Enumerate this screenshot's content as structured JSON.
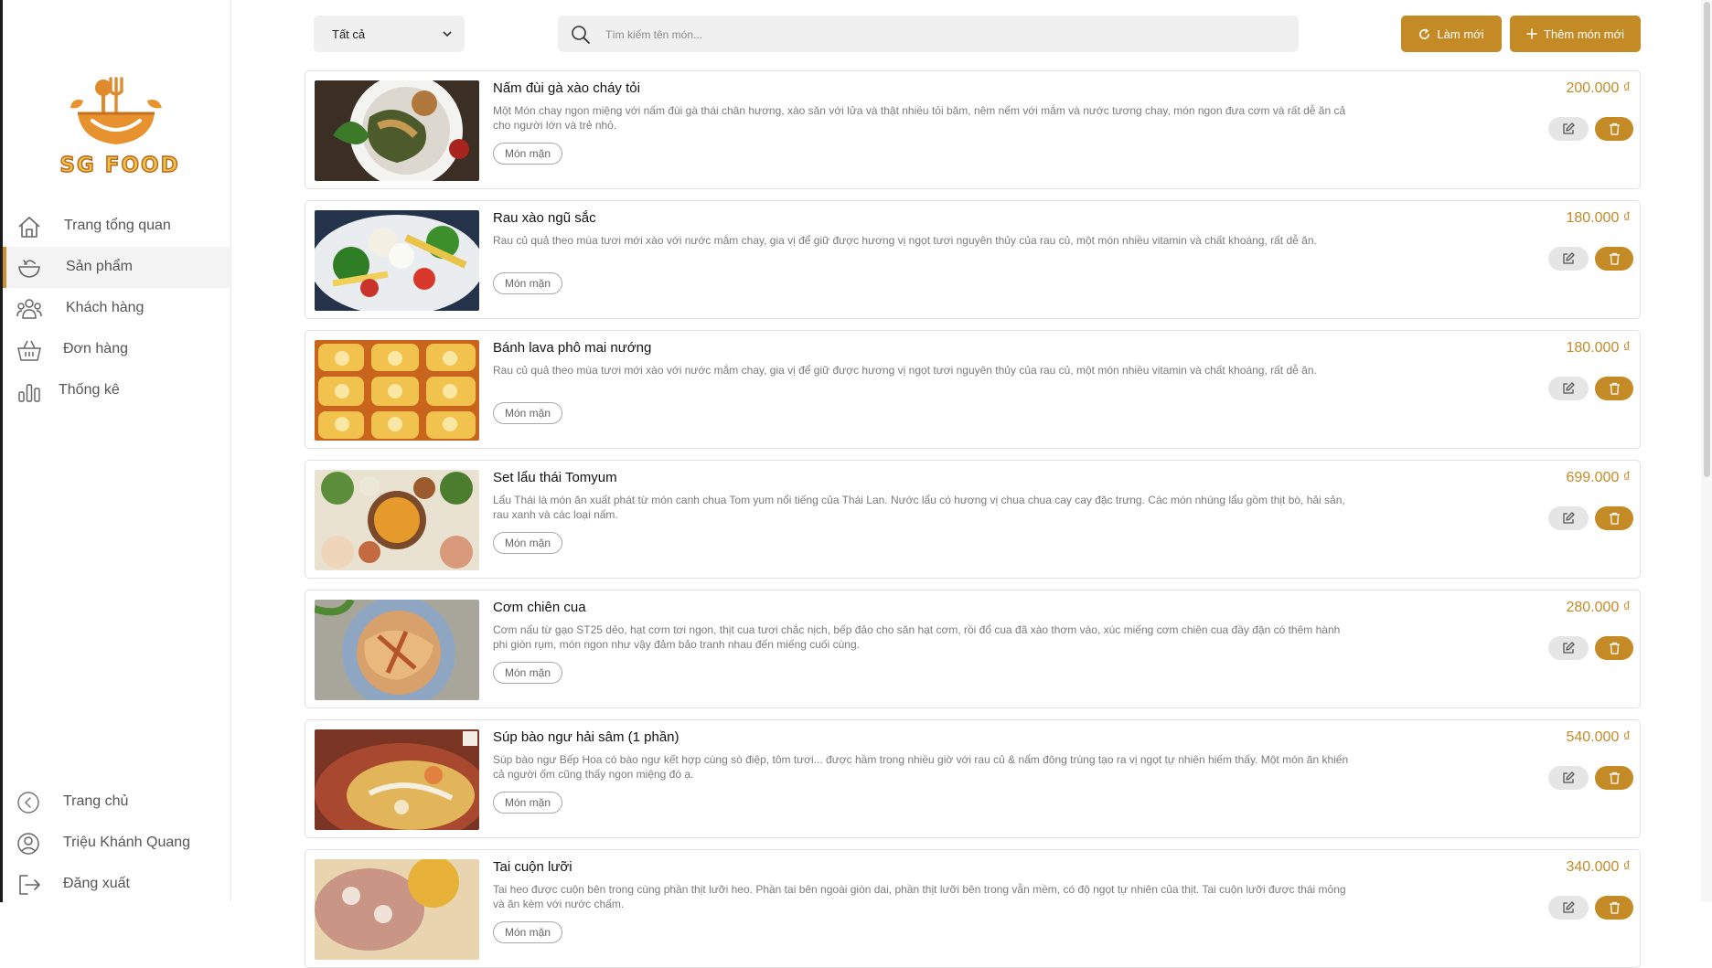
{
  "brand": {
    "logo_text": "SG FOOD"
  },
  "sidebar": {
    "nav": [
      {
        "label": "Trang tổng quan"
      },
      {
        "label": "Sản phẩm"
      },
      {
        "label": "Khách hàng"
      },
      {
        "label": "Đơn hàng"
      },
      {
        "label": "Thống kê"
      }
    ],
    "bottom": [
      {
        "label": "Trang chủ"
      },
      {
        "label": "Triệu Khánh Quang"
      },
      {
        "label": "Đăng xuất"
      }
    ]
  },
  "toolbar": {
    "filter_value": "Tất cả",
    "search_placeholder": "Tìm kiếm tên món...",
    "refresh_label": "Làm mới",
    "add_label": "Thêm món mới"
  },
  "products": [
    {
      "name": "Nấm đùi gà xào cháy tỏi",
      "description": "Một Món chay ngon miệng với nấm đùi gà thái chân hương, xào săn với lửa và thật nhiều tỏi băm, nêm nếm với mắm và nước tương chay, món ngon đưa cơm và rất dễ ăn cả cho người lớn và trẻ nhỏ.",
      "tag": "Món mặn",
      "price": "200.000 ₫"
    },
    {
      "name": "Rau xào ngũ sắc",
      "description": "Rau củ quả theo mùa tươi mới xào với nước mắm chay, gia vị để giữ được hương vị ngọt tươi nguyên thủy của rau củ, một món nhiều vitamin và chất khoáng, rất dễ ăn.",
      "tag": "Món mặn",
      "price": "180.000 ₫"
    },
    {
      "name": "Bánh lava phô mai nướng",
      "description": "Rau củ quả theo mùa tươi mới xào với nước mắm chay, gia vị để giữ được hương vị ngọt tươi nguyên thủy của rau củ, một món nhiều vitamin và chất khoáng, rất dễ ăn.",
      "tag": "Món mặn",
      "price": "180.000 ₫"
    },
    {
      "name": "Set lẩu thái Tomyum",
      "description": "Lẩu Thái là món ăn xuất phát từ món canh chua Tom yum nổi tiếng của Thái Lan. Nước lẩu có hương vị chua chua cay cay đặc trưng. Các món nhúng lẩu gồm thịt bò, hải sản, rau xanh và các loại nấm.",
      "tag": "Món mặn",
      "price": "699.000 ₫"
    },
    {
      "name": "Cơm chiên cua",
      "description": "Cơm nấu từ gạo ST25 dẻo, hạt cơm tơi ngon, thịt cua tươi chắc nịch, bếp đảo cho săn hạt cơm, rồi đổ cua đã xào thơm vào, xúc miếng cơm chiên cua đầy đặn có thêm hành phi giòn rụm, món ngon như vậy đảm bảo tranh nhau đến miếng cuối cùng.",
      "tag": "Món mặn",
      "price": "280.000 ₫"
    },
    {
      "name": "Súp bào ngư hải sâm (1 phần)",
      "description": "Súp bào ngư Bếp Hoa có bào ngư kết hợp cùng sò điệp, tôm tươi... được hầm trong nhiều giờ với rau củ & nấm đông trùng tạo ra vị ngọt tự nhiên hiếm thấy. Một món ăn khiến cả người ốm cũng thấy ngon miệng đó ạ.",
      "tag": "Món mặn",
      "price": "540.000 ₫"
    },
    {
      "name": "Tai cuộn lưỡi",
      "description": "Tai heo được cuộn bên trong cùng phần thịt lưỡi heo. Phần tai bên ngoài giòn dai, phần thịt lưỡi bên trong vẫn mềm, có độ ngọt tự nhiên của thịt. Tai cuộn lưỡi được thái mỏng và ăn kèm với nước chấm.",
      "tag": "Món mặn",
      "price": "340.000 ₫"
    }
  ],
  "colors": {
    "accent": "#c48a26",
    "nav_active": "#f3f3f3",
    "card_border": "#e1e1e1"
  }
}
